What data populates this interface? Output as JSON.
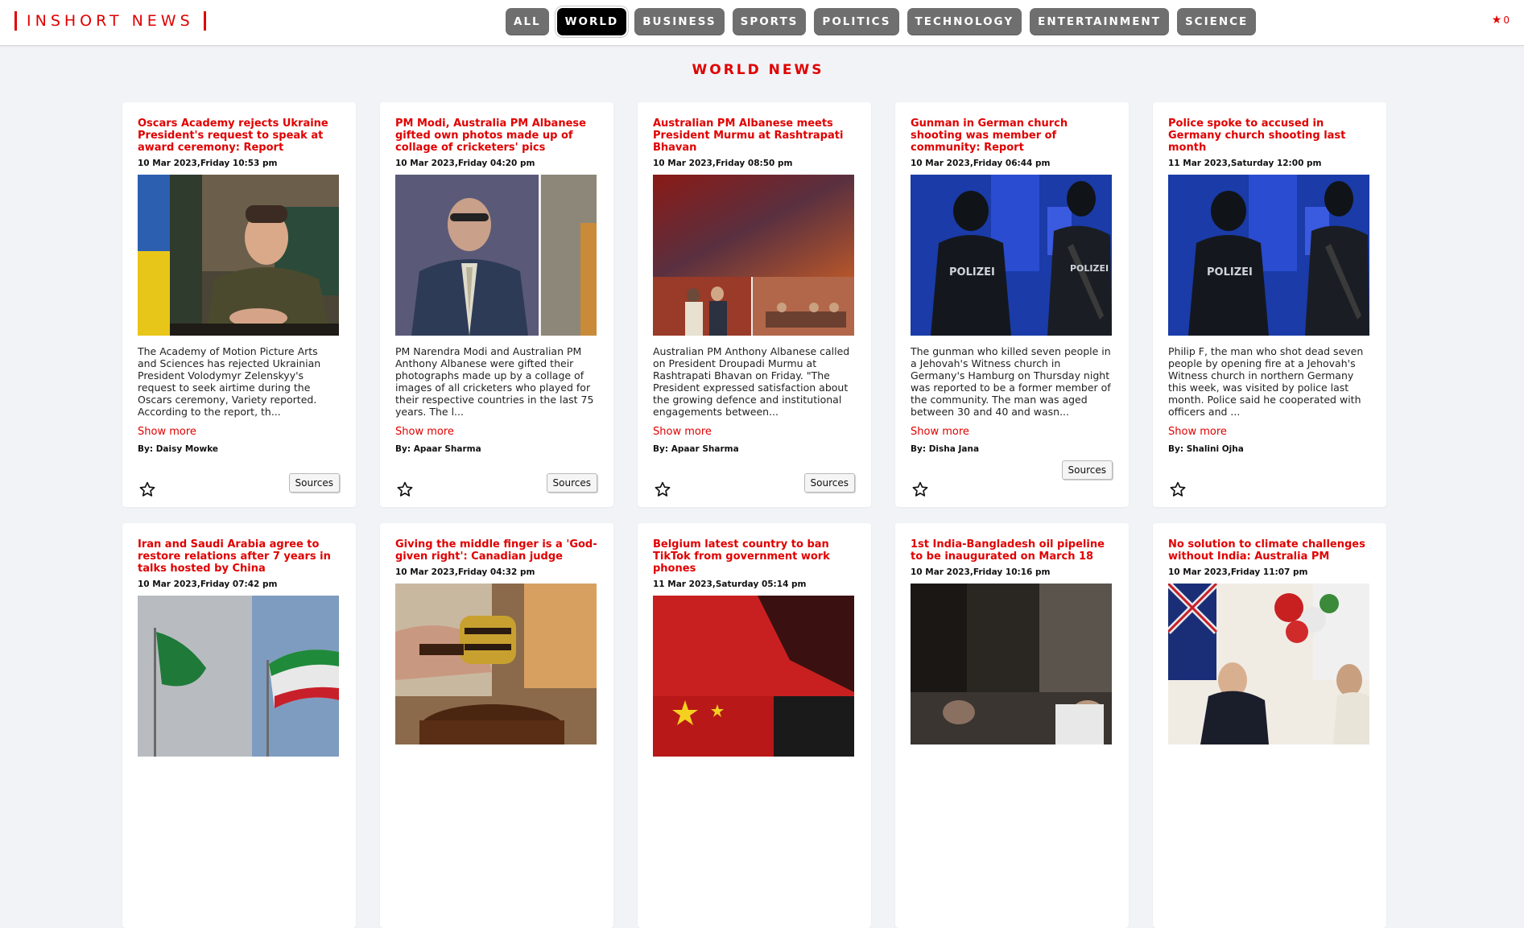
{
  "brand": {
    "name": "INSHORT NEWS"
  },
  "nav": [
    {
      "label": "ALL",
      "active": false
    },
    {
      "label": "WORLD",
      "active": true
    },
    {
      "label": "BUSINESS",
      "active": false
    },
    {
      "label": "SPORTS",
      "active": false
    },
    {
      "label": "POLITICS",
      "active": false
    },
    {
      "label": "TECHNOLOGY",
      "active": false
    },
    {
      "label": "ENTERTAINMENT",
      "active": false
    },
    {
      "label": "SCIENCE",
      "active": false
    }
  ],
  "favorites": {
    "icon": "star-icon",
    "count": "0"
  },
  "page": {
    "title": "WORLD NEWS"
  },
  "colors": {
    "accent": "#e00000",
    "nav_bg": "#6f6f6f",
    "nav_active": "#000000",
    "page_bg": "#f1f3f7"
  },
  "cards": [
    {
      "title": "Oscars Academy rejects Ukraine President's request to speak at award ceremony: Report",
      "date": "10 Mar 2023,Friday 10:53 pm",
      "image": "zelensky-photo",
      "desc": "The Academy of Motion Picture Arts and Sciences has rejected Ukrainian President Volodymyr Zelenskyy's request to seek airtime during the Oscars ceremony, Variety reported. According to the report, th...",
      "show_more": "Show more",
      "byline": "By: Daisy Mowke",
      "sources": "Sources"
    },
    {
      "title": "PM Modi, Australia PM Albanese gifted own photos made up of collage of cricketers' pics",
      "date": "10 Mar 2023,Friday 04:20 pm",
      "image": "albanese-collage-photo",
      "desc": "PM Narendra Modi and Australian PM Anthony Albanese were gifted their photographs made up by a collage of images of all cricketers who played for their respective countries in the last 75 years. The l...",
      "show_more": "Show more",
      "byline": "By: Apaar Sharma",
      "sources": "Sources"
    },
    {
      "title": "Australian PM Albanese meets President Murmu at Rashtrapati Bhavan",
      "date": "10 Mar 2023,Friday 08:50 pm",
      "image": "albanese-murmu-photo",
      "desc": "Australian PM Anthony Albanese called on President Droupadi Murmu at Rashtrapati Bhavan on Friday. \"The President expressed satisfaction about the growing defence and institutional engagements between...",
      "show_more": "Show more",
      "byline": "By: Apaar Sharma",
      "sources": "Sources"
    },
    {
      "title": "Gunman in German church shooting was member of community: Report",
      "date": "10 Mar 2023,Friday 06:44 pm",
      "image": "police-photo",
      "desc": "The gunman who killed seven people in a Jehovah's Witness church in Germany's Hamburg on Thursday night was reported to be a former member of the community. The man was aged between 30 and 40 and wasn...",
      "show_more": "Show more",
      "byline": "By: Disha Jana",
      "sources": "Sources"
    },
    {
      "title": "Police spoke to accused in Germany church shooting last month",
      "date": "11 Mar 2023,Saturday 12:00 pm",
      "image": "police-photo",
      "desc": "Philip F, the man who shot dead seven people by opening fire at a Jehovah's Witness church in northern Germany this week, was visited by police last month. Police said he cooperated with officers and ...",
      "show_more": "Show more",
      "byline": "By: Shalini Ojha",
      "sources": ""
    },
    {
      "title": "Iran and Saudi Arabia agree to restore relations after 7 years in talks hosted by China",
      "date": "10 Mar 2023,Friday 07:42 pm",
      "image": "flags-photo"
    },
    {
      "title": "Giving the middle finger is a 'God-given right': Canadian judge",
      "date": "10 Mar 2023,Friday 04:32 pm",
      "image": "gavel-photo"
    },
    {
      "title": "Belgium latest country to ban TikTok from government work phones",
      "date": "11 Mar 2023,Saturday 05:14 pm",
      "image": "tiktok-china-photo"
    },
    {
      "title": "1st India-Bangladesh oil pipeline to be inaugurated on March 18",
      "date": "10 Mar 2023,Friday 10:16 pm",
      "image": "pipeline-photo"
    },
    {
      "title": "No solution to climate challenges without India: Australia PM",
      "date": "10 Mar 2023,Friday 11:07 pm",
      "image": "albanese-modi-photo"
    }
  ]
}
